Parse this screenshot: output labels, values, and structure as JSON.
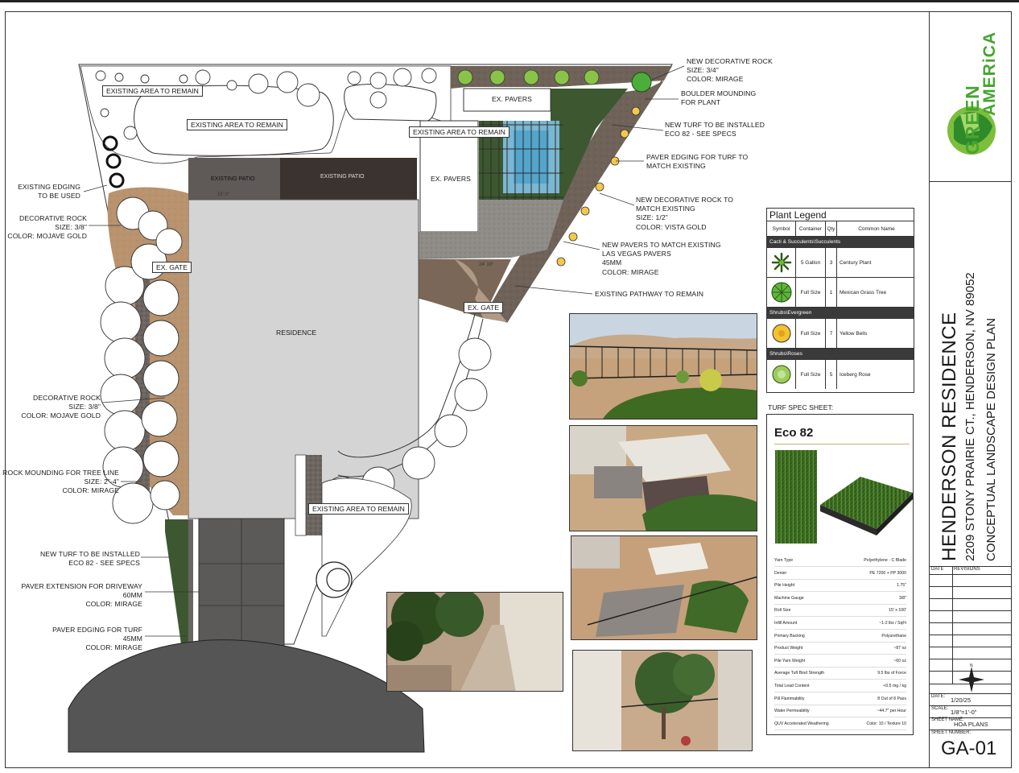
{
  "title_block": {
    "logo_text_1": "GREEN",
    "logo_text_2": "AMERiCA",
    "project_name": "HENDERSON RESIDENCE",
    "address": "2209 STONY PRAIRIE CT., HENDERSON, NV 89052",
    "plan_title": "CONCEPTUAL LANDSCAPE DESIGN PLAN",
    "date_label": "DATE",
    "revisions_label": "REVISIONS",
    "date_key": "DATE:",
    "date_value": "1/20/25",
    "scale_key": "SCALE:",
    "scale_value": "1/8\"=1'-0\"",
    "sheet_name_key": "SHEET NAME:",
    "sheet_name_value": "HOA PLANS",
    "sheet_number_key": "SHEET NUMBER:",
    "sheet_number_value": "GA-01"
  },
  "plan": {
    "residence": "RESIDENCE",
    "existing_patio_1": "EXISTING PATIO",
    "existing_patio_2": "EXISTING PATIO",
    "ex_pavers_1": "EX. PAVERS",
    "ex_pavers_2": "EX. PAVERS",
    "ex_gate_1": "EX. GATE",
    "ex_gate_2": "EX. GATE",
    "existing_area_1": "EXISTING AREA TO REMAIN",
    "existing_area_2": "EXISTING AREA TO REMAIN",
    "existing_area_3": "EXISTING AREA TO REMAIN",
    "existing_area_4": "EXISTING AREA TO REMAIN",
    "dim_1": "15' 0\"",
    "dim_2": "24' 10\""
  },
  "callouts_right": [
    {
      "lines": [
        "NEW DECORATIVE ROCK",
        "SIZE: 3/4\"",
        "COLOR: MIRAGE"
      ]
    },
    {
      "lines": [
        "BOULDER MOUNDING",
        "FOR PLANT"
      ]
    },
    {
      "lines": [
        "NEW TURF TO BE INSTALLED",
        "ECO 82 - SEE SPECS"
      ]
    },
    {
      "lines": [
        "PAVER EDGING FOR TURF TO",
        "MATCH EXISTING"
      ]
    },
    {
      "lines": [
        "NEW DECORATIVE ROCK TO",
        "MATCH EXISTING",
        "SIZE: 1/2\"",
        "COLOR: VISTA GOLD"
      ]
    },
    {
      "lines": [
        "NEW PAVERS TO MATCH EXISTING",
        "LAS VEGAS PAVERS",
        "45MM",
        "COLOR: MIRAGE"
      ]
    },
    {
      "lines": [
        "EXISTING PATHWAY TO REMAIN"
      ]
    }
  ],
  "callouts_left": [
    {
      "lines": [
        "EXISTING EDGING",
        "TO BE USED"
      ]
    },
    {
      "lines": [
        "DECORATIVE ROCK",
        "SIZE: 3/8\"",
        "COLOR: MOJAVE GOLD"
      ]
    },
    {
      "lines": [
        "DECORATIVE ROCK",
        "SIZE: 3/8\"",
        "COLOR: MOJAVE GOLD"
      ]
    },
    {
      "lines": [
        "ROCK MOUNDING FOR TREE LINE",
        "SIZE: 2\"-4\"",
        "COLOR: MIRAGE"
      ]
    },
    {
      "lines": [
        "NEW TURF TO BE INSTALLED",
        "ECO 82 - SEE SPECS"
      ]
    },
    {
      "lines": [
        "PAVER EXTENSION FOR DRIVEWAY",
        "60MM",
        "COLOR: MIRAGE"
      ]
    },
    {
      "lines": [
        "PAVER EDGING FOR TURF",
        "45MM",
        "COLOR: MIRAGE"
      ]
    }
  ],
  "legend": {
    "title": "Plant Legend",
    "headers": [
      "Symbol",
      "Container",
      "Qty",
      "Common Name"
    ],
    "groups": [
      {
        "category": "Cacti & Succulents\\Succulents",
        "rows": [
          {
            "icon": "century-plant-icon",
            "container": "5 Gallon",
            "qty": "3",
            "name": "Century Plant"
          },
          {
            "icon": "mexican-grass-tree-icon",
            "container": "Full Size",
            "qty": "1",
            "name": "Mexican Grass Tree"
          }
        ]
      },
      {
        "category": "Shrubs\\Evergreen",
        "rows": [
          {
            "icon": "yellow-bells-icon",
            "container": "Full Size",
            "qty": "7",
            "name": "Yellow Bells"
          }
        ]
      },
      {
        "category": "Shrubs\\Roses",
        "rows": [
          {
            "icon": "iceberg-rose-icon",
            "container": "Full Size",
            "qty": "5",
            "name": "Iceberg Rose"
          }
        ]
      }
    ]
  },
  "turf": {
    "section_label": "TURF SPEC SHEET:",
    "product": "Eco 82",
    "specs": [
      {
        "k": "Yarn Type",
        "v": "Polyethylene - C Blade"
      },
      {
        "k": "Denier",
        "v": "PE 7200 + PP 3000"
      },
      {
        "k": "Pile Height",
        "v": "1.75\""
      },
      {
        "k": "Machine Gauge",
        "v": "3/8\""
      },
      {
        "k": "Roll Size",
        "v": "15' x 100'"
      },
      {
        "k": "Infill Amount",
        "v": "~1-2 lbs / SqFt"
      },
      {
        "k": "Primary Backing",
        "v": "Polyurethane"
      },
      {
        "k": "Product Weight",
        "v": "~87 oz"
      },
      {
        "k": "Pile Yarn Weight",
        "v": "~60 oz"
      },
      {
        "k": "Average Tuft Bind Strength",
        "v": "9.5 lbs of Force"
      },
      {
        "k": "Total Lead Content",
        "v": "<0.5 mg / kg"
      },
      {
        "k": "Pill Flammability",
        "v": "8 Out of 8 Pass"
      },
      {
        "k": "Water Permeability",
        "v": "~44.7\" per Hour"
      },
      {
        "k": "QUV Accelerated Weathering",
        "v": "Color: 10 / Texture 10"
      }
    ]
  },
  "colors": {
    "rock_mirage": "#6e6258",
    "rock_mojave": "#b89470",
    "turf": "#3e5730",
    "residence": "#d6d6d6",
    "patio": "#3a3330",
    "pavers": "#8a8784"
  }
}
